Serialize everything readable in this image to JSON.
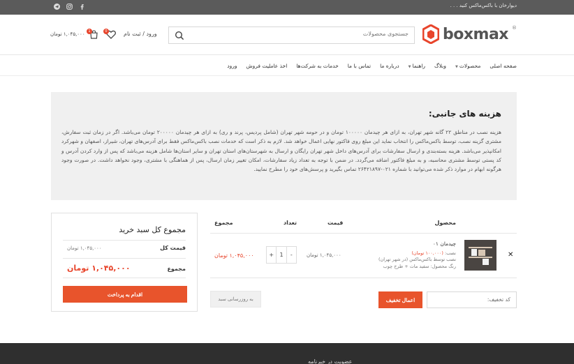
{
  "topbar": {
    "welcome": "دیوارخان با باکس‌ماکس کنید . . .",
    "social": [
      "telegram-icon",
      "instagram-icon",
      "facebook-icon"
    ]
  },
  "header": {
    "logo_text": "boxmax",
    "logo_reg": "®",
    "search_placeholder": "جستجوی محصولات",
    "login_label": "ورود / ثبت نام",
    "wishlist_count": "0",
    "cart_count": "1",
    "cart_total": "۱,۰۴۵,۰۰۰ تومان"
  },
  "nav": {
    "items": [
      {
        "label": "صفحه اصلی",
        "caret": false
      },
      {
        "label": "محصولات",
        "caret": true
      },
      {
        "label": "وبلاگ",
        "caret": false
      },
      {
        "label": "راهنما",
        "caret": true
      },
      {
        "label": "درباره ما",
        "caret": false
      },
      {
        "label": "تماس با ما",
        "caret": false
      },
      {
        "label": "خدمات به شرکت‌ها",
        "caret": false
      },
      {
        "label": "اخذ عاملیت فروش",
        "caret": false
      },
      {
        "label": "ورود",
        "caret": false
      }
    ]
  },
  "info": {
    "title": "هزینه های جانبی:",
    "body": "هزینه نصب در مناطق ۲۲ گانه شهر تهران، به ازای هر چیدمان ۱۰۰۰۰۰ تومان و در حومه شهر تهران (شامل پردیس، پرند و ری) به ازای هر چیدمان ۲۰۰۰۰۰ تومان می‌باشد. اگر در زمان ثبت سفارش، مشتری گزینه نصب، توسط باکس‌ماکس را انتخاب نماید این مبلغ روی فاکتور نهایی اعمال خواهد شد. لازم به ذکر است که خدمات نصب باکس‌ماکس فقط برای آدرس‌های تهران، شیراز، اصفهان و شهرکرد امکانپذیر می‌باشد. هزینه بسته‌بندی و ارسال سفارشات برای آدرس‌های داخل شهر تهران رایگان و ارسال به شهرستان‌های استان تهران و سایر استان‌ها شامل هزینه می‌باشد که پس از وارد کردن آدرس و کد پستی توسط مشتری محاسبه، و به مبلغ فاکتور اضافه می‌گردد. در ضمن با توجه به تعداد زیاد سفارشات، امکان تغییر زمان ارسال، پس از هماهنگی با مشتری، وجود نخواهد داشت. در صورت وجود هرگونه ابهام در موارد ذکر شده می‌توانید با شماره ۰۲۱-۲۶۴۲۱۸۹۷ تماس بگیرید و پرسش‌های خود را مطرح نمایید."
  },
  "cart": {
    "headers": {
      "product": "محصول",
      "price": "قیمت",
      "qty": "تعداد",
      "subtotal": "مجموع"
    },
    "item": {
      "name": "چیدمان ۰۱",
      "install_label": "نصب:",
      "install_value": "(۱۰۰,۰۰۰ تومان)",
      "install_by": "نصب توسط باکس‌ماکس (در شهر تهران)",
      "color": "رنگ محصول: سفید مات + طرح چوب",
      "price": "۱,۰۴۵,۰۰۰ تومان",
      "qty": "1",
      "subtotal": "۱,۰۴۵,۰۰۰ تومان"
    },
    "coupon_placeholder": "کد تخفیف:",
    "apply_label": "اعمال تخفیف",
    "update_label": "به روزرسانی سبد"
  },
  "totals": {
    "title": "مجموع کل سبد خرید",
    "price_label": "قیمت کل",
    "price_value": "۱,۰۴۵,۰۰۰ تومان",
    "total_label": "مجموع",
    "total_value": "۱,۰۴۵,۰۰۰ تومان",
    "checkout_label": "اقدام به پرداخت"
  },
  "footer": {
    "newsletter_title": "عضویت در خبرنامه"
  },
  "colors": {
    "accent": "#e8542c",
    "topbar": "#5b5b5b",
    "footer": "#2f2f2f"
  }
}
